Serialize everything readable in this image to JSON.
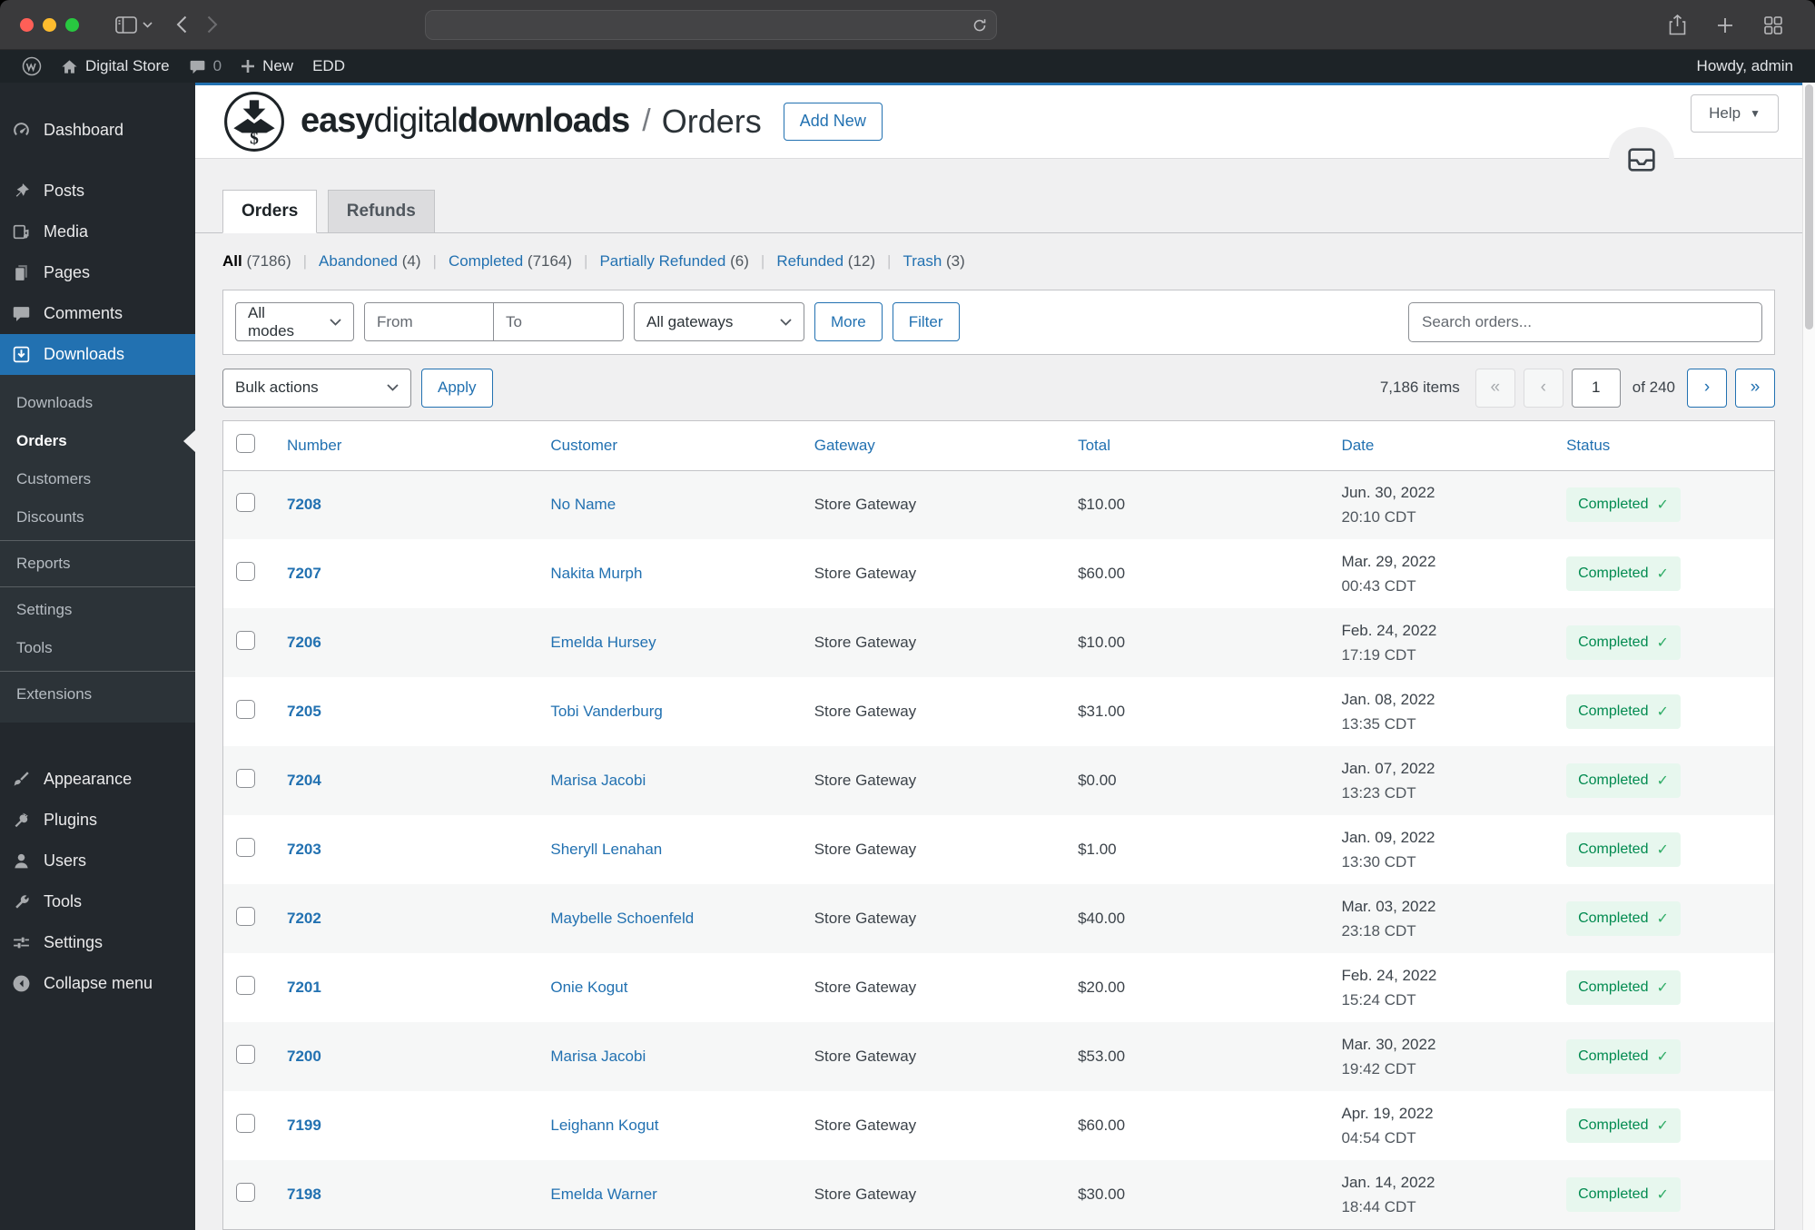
{
  "admin_bar": {
    "site_name": "Digital Store",
    "comments_count": "0",
    "new_label": "New",
    "edd_label": "EDD",
    "howdy": "Howdy, admin"
  },
  "sidebar": {
    "items": [
      {
        "label": "Dashboard"
      },
      {
        "label": "Posts"
      },
      {
        "label": "Media"
      },
      {
        "label": "Pages"
      },
      {
        "label": "Comments"
      },
      {
        "label": "Downloads"
      },
      {
        "label": "Appearance"
      },
      {
        "label": "Plugins"
      },
      {
        "label": "Users"
      },
      {
        "label": "Tools"
      },
      {
        "label": "Settings"
      },
      {
        "label": "Collapse menu"
      }
    ],
    "submenu": [
      {
        "label": "Downloads"
      },
      {
        "label": "Orders"
      },
      {
        "label": "Customers"
      },
      {
        "label": "Discounts"
      },
      {
        "label": "Reports"
      },
      {
        "label": "Settings"
      },
      {
        "label": "Tools"
      },
      {
        "label": "Extensions"
      }
    ]
  },
  "header": {
    "brand_easy": "easy",
    "brand_digital": "digital",
    "brand_downloads": "downloads",
    "crumb_sep": "/",
    "title": "Orders",
    "add_new_label": "Add New",
    "help_label": "Help"
  },
  "tabs": [
    {
      "label": "Orders"
    },
    {
      "label": "Refunds"
    }
  ],
  "status_filters": [
    {
      "label": "All",
      "count": "(7186)"
    },
    {
      "label": "Abandoned",
      "count": "(4)"
    },
    {
      "label": "Completed",
      "count": "(7164)"
    },
    {
      "label": "Partially Refunded",
      "count": "(6)"
    },
    {
      "label": "Refunded",
      "count": "(12)"
    },
    {
      "label": "Trash",
      "count": "(3)"
    }
  ],
  "ui": {
    "divider": "|"
  },
  "filters": {
    "all_modes": "All modes",
    "from_placeholder": "From",
    "to_placeholder": "To",
    "all_gateways": "All gateways",
    "more_label": "More",
    "filter_label": "Filter",
    "search_placeholder": "Search orders..."
  },
  "bulk": {
    "label": "Bulk actions",
    "apply_label": "Apply"
  },
  "pagination": {
    "items_label": "7,186 items",
    "first": "«",
    "prev": "‹",
    "page_value": "1",
    "of_label": "of 240",
    "next": "›",
    "last": "»"
  },
  "table": {
    "columns": [
      "Number",
      "Customer",
      "Gateway",
      "Total",
      "Date",
      "Status"
    ],
    "check_mark": "✓",
    "rows": [
      {
        "number": "7208",
        "customer": "No Name",
        "gateway": "Store Gateway",
        "total": "$10.00",
        "date": "Jun. 30, 2022",
        "time": "20:10 CDT",
        "status": "Completed"
      },
      {
        "number": "7207",
        "customer": "Nakita Murph",
        "gateway": "Store Gateway",
        "total": "$60.00",
        "date": "Mar. 29, 2022",
        "time": "00:43 CDT",
        "status": "Completed"
      },
      {
        "number": "7206",
        "customer": "Emelda Hursey",
        "gateway": "Store Gateway",
        "total": "$10.00",
        "date": "Feb. 24, 2022",
        "time": "17:19 CDT",
        "status": "Completed"
      },
      {
        "number": "7205",
        "customer": "Tobi Vanderburg",
        "gateway": "Store Gateway",
        "total": "$31.00",
        "date": "Jan. 08, 2022",
        "time": "13:35 CDT",
        "status": "Completed"
      },
      {
        "number": "7204",
        "customer": "Marisa Jacobi",
        "gateway": "Store Gateway",
        "total": "$0.00",
        "date": "Jan. 07, 2022",
        "time": "13:23 CDT",
        "status": "Completed"
      },
      {
        "number": "7203",
        "customer": "Sheryll Lenahan",
        "gateway": "Store Gateway",
        "total": "$1.00",
        "date": "Jan. 09, 2022",
        "time": "13:30 CDT",
        "status": "Completed"
      },
      {
        "number": "7202",
        "customer": "Maybelle Schoenfeld",
        "gateway": "Store Gateway",
        "total": "$40.00",
        "date": "Mar. 03, 2022",
        "time": "23:18 CDT",
        "status": "Completed"
      },
      {
        "number": "7201",
        "customer": "Onie Kogut",
        "gateway": "Store Gateway",
        "total": "$20.00",
        "date": "Feb. 24, 2022",
        "time": "15:24 CDT",
        "status": "Completed"
      },
      {
        "number": "7200",
        "customer": "Marisa Jacobi",
        "gateway": "Store Gateway",
        "total": "$53.00",
        "date": "Mar. 30, 2022",
        "time": "19:42 CDT",
        "status": "Completed"
      },
      {
        "number": "7199",
        "customer": "Leighann Kogut",
        "gateway": "Store Gateway",
        "total": "$60.00",
        "date": "Apr. 19, 2022",
        "time": "04:54 CDT",
        "status": "Completed"
      },
      {
        "number": "7198",
        "customer": "Emelda Warner",
        "gateway": "Store Gateway",
        "total": "$30.00",
        "date": "Jan. 14, 2022",
        "time": "18:44 CDT",
        "status": "Completed"
      }
    ]
  },
  "colors": {
    "accent_blue": "#2271b1",
    "badge_bg": "#e7f7ee",
    "badge_text": "#008a4f",
    "sidebar_bg": "#23282d",
    "adminbar_bg": "#1d2327",
    "content_bg": "#f0f0f1",
    "traffic_red": "#ff5f57",
    "traffic_yellow": "#febc2e",
    "traffic_green": "#28c840"
  }
}
